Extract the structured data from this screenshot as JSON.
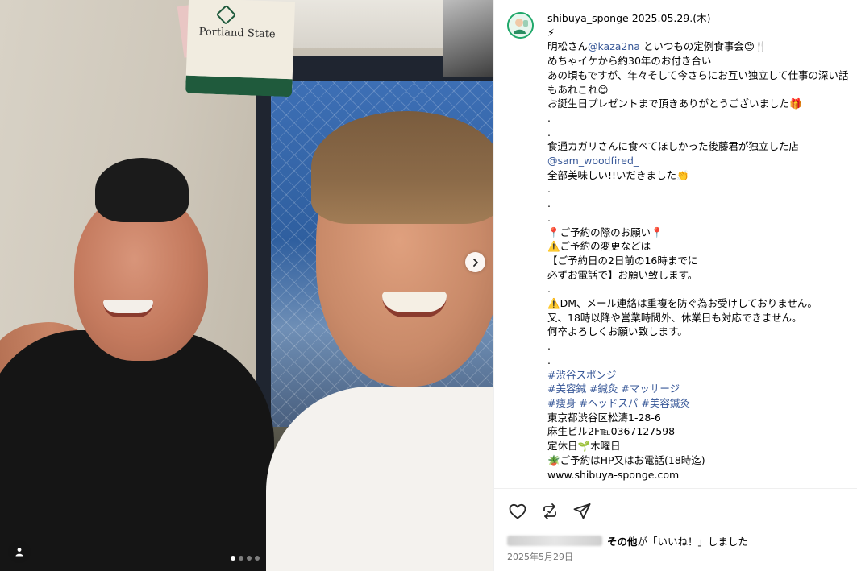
{
  "post": {
    "username": "shibuya_sponge",
    "date_header": "2025.05.29.(木)",
    "caption_lines": [
      {
        "type": "text",
        "text": "⚡"
      },
      {
        "type": "mention_line",
        "before": "明松さん",
        "mention": "@kaza2na",
        "after": " といつもの定例食事会😊🍴"
      },
      {
        "type": "text",
        "text": "めちゃイケから約30年のお付き合い"
      },
      {
        "type": "text",
        "text": "あの頃もですが、年々そして今さらにお互い独立して仕事の深い話もあれこれ😊"
      },
      {
        "type": "text",
        "text": "お誕生日プレゼントまで頂きありがとうございました🎁"
      },
      {
        "type": "text",
        "text": "."
      },
      {
        "type": "text",
        "text": "."
      },
      {
        "type": "text",
        "text": "食通カガリさんに食べてほしかった後藤君が独立した店"
      },
      {
        "type": "mention",
        "text": "@sam_woodfired_"
      },
      {
        "type": "text",
        "text": "全部美味しい!!いだきました👏"
      },
      {
        "type": "text",
        "text": "."
      },
      {
        "type": "text",
        "text": "."
      },
      {
        "type": "text",
        "text": "."
      },
      {
        "type": "text",
        "text": "📍ご予約の際のお願い📍"
      },
      {
        "type": "text",
        "text": "⚠️ご予約の変更などは"
      },
      {
        "type": "text",
        "text": "【ご予約日の2日前の16時までに"
      },
      {
        "type": "text",
        "text": "必ずお電話で】お願い致します。"
      },
      {
        "type": "text",
        "text": "."
      },
      {
        "type": "text",
        "text": "⚠️DM、メール連絡は重複を防ぐ為お受けしておりません。"
      },
      {
        "type": "text",
        "text": "又、18時以降や営業時間外、休業日も対応できません。"
      },
      {
        "type": "text",
        "text": "何卒よろしくお願い致します。"
      },
      {
        "type": "text",
        "text": "."
      },
      {
        "type": "text",
        "text": "."
      },
      {
        "type": "hashtags",
        "text": "#渋谷スポンジ"
      },
      {
        "type": "hashtags",
        "text": "#美容鍼 #鍼灸 #マッサージ"
      },
      {
        "type": "hashtags",
        "text": "#痩身 #ヘッドスパ #美容鍼灸"
      },
      {
        "type": "text",
        "text": "東京都渋谷区松濤1-28-6"
      },
      {
        "type": "text",
        "text": "麻生ビル2F℡0367127598"
      },
      {
        "type": "text",
        "text": "定休日🌱木曜日"
      },
      {
        "type": "text",
        "text": "🪴ご予約はHP又はお電話(18時迄)"
      },
      {
        "type": "text",
        "text": "www.shibuya-sponge.com"
      }
    ],
    "likes_suffix": "その他",
    "likes_text": "が「いいね！」しました",
    "post_date": "2025年5月29日"
  },
  "media": {
    "tote_text": "Portland State",
    "carousel_total": 4,
    "carousel_active": 1
  },
  "icons": {
    "like": "heart-icon",
    "repost": "repost-icon",
    "share": "send-icon",
    "next": "chevron-right-icon",
    "tagged": "user-icon"
  },
  "colors": {
    "link": "#385898",
    "avatar_ring": "#1fa86a",
    "meta": "#737373"
  }
}
